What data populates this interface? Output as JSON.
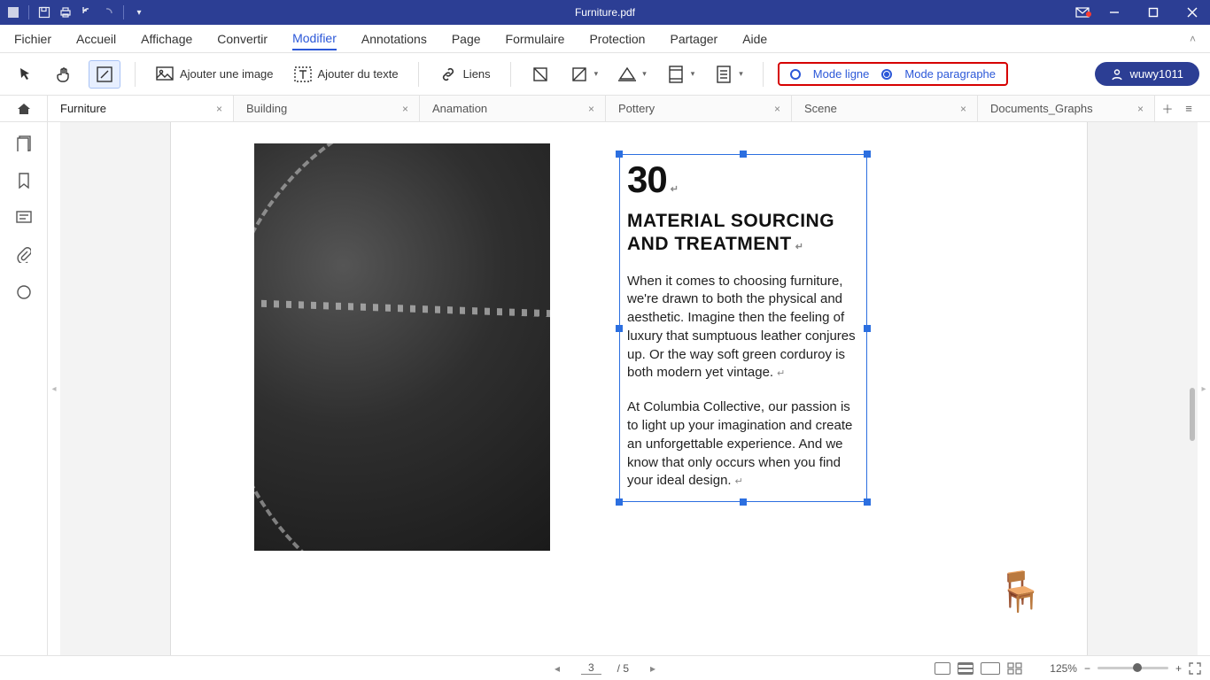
{
  "app": {
    "title": "Furniture.pdf"
  },
  "menu": {
    "items": [
      "Fichier",
      "Accueil",
      "Affichage",
      "Convertir",
      "Modifier",
      "Annotations",
      "Page",
      "Formulaire",
      "Protection",
      "Partager",
      "Aide"
    ],
    "active_index": 4
  },
  "toolbar": {
    "add_image": "Ajouter une image",
    "add_text": "Ajouter du texte",
    "links": "Liens",
    "mode_line": "Mode ligne",
    "mode_paragraph": "Mode paragraphe",
    "mode_selected": "paragraph",
    "user": "wuwy1011"
  },
  "tabs": {
    "items": [
      "Furniture",
      "Building",
      "Anamation",
      "Pottery",
      "Scene",
      "Documents_Graphs"
    ],
    "active_index": 0
  },
  "document": {
    "number": "30",
    "heading": "MATERIAL SOURCING AND TREATMENT",
    "para1": "When it comes to choosing furniture, we're drawn to both the physical and aesthetic. Imagine then the feeling of luxury that sumptuous leather conjures up. Or the way soft green corduroy is both modern yet vintage.",
    "para2": "At Columbia Collective, our passion is to light up your imagination and create an unforgettable experience. And we know that only occurs when you find your ideal design."
  },
  "status": {
    "page_current": "3",
    "page_total": "/ 5",
    "zoom": "125%"
  }
}
